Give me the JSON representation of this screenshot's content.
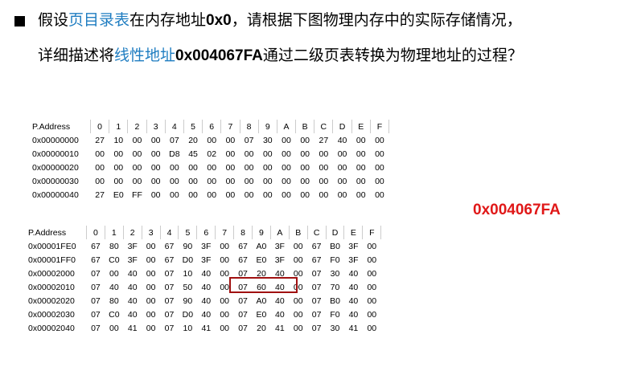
{
  "question": {
    "line1": {
      "a": "假设",
      "b": "页目录表",
      "c": "在内存地址",
      "d": "0x0",
      "e": "，请根据下图物理内存中的实际存储情况，"
    },
    "line2": {
      "a": "详细描述将",
      "b": "线性地址",
      "c": "0x004067FA",
      "d": "通过二级页表转换为物理地址的过程？"
    }
  },
  "highlight_address": "0x004067FA",
  "table1": {
    "header": [
      "P.Address",
      "0",
      "1",
      "2",
      "3",
      "4",
      "5",
      "6",
      "7",
      "8",
      "9",
      "A",
      "B",
      "C",
      "D",
      "E",
      "F"
    ],
    "rows": [
      [
        "0x00000000",
        "27",
        "10",
        "00",
        "00",
        "07",
        "20",
        "00",
        "00",
        "07",
        "30",
        "00",
        "00",
        "27",
        "40",
        "00",
        "00"
      ],
      [
        "0x00000010",
        "00",
        "00",
        "00",
        "00",
        "D8",
        "45",
        "02",
        "00",
        "00",
        "00",
        "00",
        "00",
        "00",
        "00",
        "00",
        "00"
      ],
      [
        "0x00000020",
        "00",
        "00",
        "00",
        "00",
        "00",
        "00",
        "00",
        "00",
        "00",
        "00",
        "00",
        "00",
        "00",
        "00",
        "00",
        "00"
      ],
      [
        "0x00000030",
        "00",
        "00",
        "00",
        "00",
        "00",
        "00",
        "00",
        "00",
        "00",
        "00",
        "00",
        "00",
        "00",
        "00",
        "00",
        "00"
      ],
      [
        "0x00000040",
        "27",
        "E0",
        "FF",
        "00",
        "00",
        "00",
        "00",
        "00",
        "00",
        "00",
        "00",
        "00",
        "00",
        "00",
        "00",
        "00"
      ]
    ]
  },
  "table2": {
    "header": [
      "P.Address",
      "0",
      "1",
      "2",
      "3",
      "4",
      "5",
      "6",
      "7",
      "8",
      "9",
      "A",
      "B",
      "C",
      "D",
      "E",
      "F"
    ],
    "rows": [
      [
        "0x00001FE0",
        "67",
        "80",
        "3F",
        "00",
        "67",
        "90",
        "3F",
        "00",
        "67",
        "A0",
        "3F",
        "00",
        "67",
        "B0",
        "3F",
        "00"
      ],
      [
        "0x00001FF0",
        "67",
        "C0",
        "3F",
        "00",
        "67",
        "D0",
        "3F",
        "00",
        "67",
        "E0",
        "3F",
        "00",
        "67",
        "F0",
        "3F",
        "00"
      ],
      [
        "0x00002000",
        "07",
        "00",
        "40",
        "00",
        "07",
        "10",
        "40",
        "00",
        "07",
        "20",
        "40",
        "00",
        "07",
        "30",
        "40",
        "00"
      ],
      [
        "0x00002010",
        "07",
        "40",
        "40",
        "00",
        "07",
        "50",
        "40",
        "00",
        "07",
        "60",
        "40",
        "00",
        "07",
        "70",
        "40",
        "00"
      ],
      [
        "0x00002020",
        "07",
        "80",
        "40",
        "00",
        "07",
        "90",
        "40",
        "00",
        "07",
        "A0",
        "40",
        "00",
        "07",
        "B0",
        "40",
        "00"
      ],
      [
        "0x00002030",
        "07",
        "C0",
        "40",
        "00",
        "07",
        "D0",
        "40",
        "00",
        "07",
        "E0",
        "40",
        "00",
        "07",
        "F0",
        "40",
        "00"
      ],
      [
        "0x00002040",
        "07",
        "00",
        "41",
        "00",
        "07",
        "10",
        "41",
        "00",
        "07",
        "20",
        "41",
        "00",
        "07",
        "30",
        "41",
        "00"
      ]
    ]
  }
}
